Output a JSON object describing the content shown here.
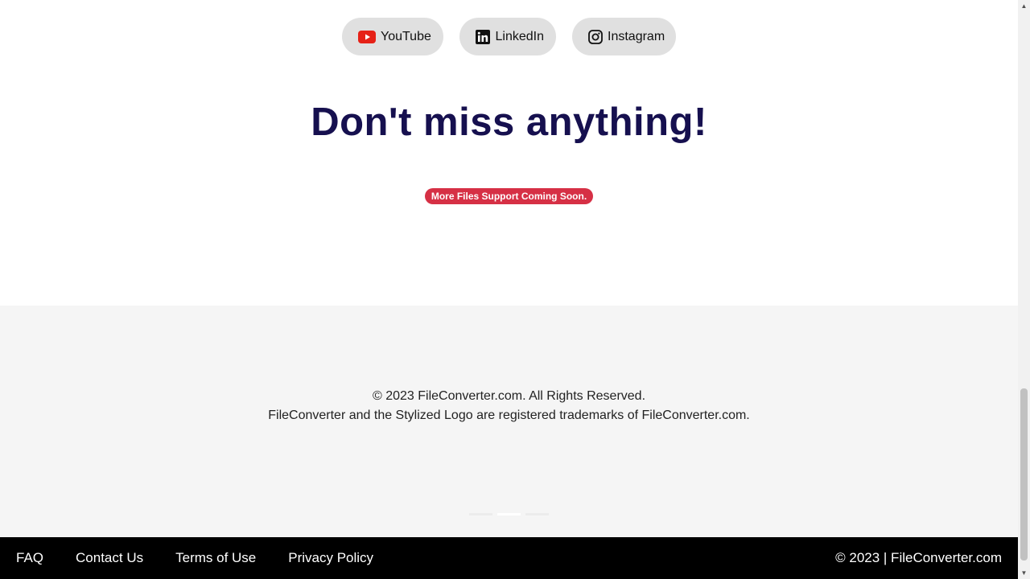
{
  "social": {
    "youtube": {
      "label": "YouTube",
      "icon": "youtube-icon",
      "color": "#e62117"
    },
    "linkedin": {
      "label": "LinkedIn",
      "icon": "linkedin-icon",
      "color": "#111111"
    },
    "instagram": {
      "label": "Instagram",
      "icon": "instagram-icon",
      "color": "#111111"
    }
  },
  "headline": "Don't miss anything!",
  "badge": "More Files Support Coming Soon.",
  "footer": {
    "copyright_line": "© 2023 FileConverter.com. All Rights Reserved.",
    "trademark_line": "FileConverter and the Stylized Logo are registered trademarks of FileConverter.com."
  },
  "carousel": {
    "active_index": 1,
    "count": 3
  },
  "bottom_nav": {
    "links": [
      "FAQ",
      "Contact Us",
      "Terms of Use",
      "Privacy Policy"
    ],
    "copyright": "© 2023 | FileConverter.com"
  },
  "colors": {
    "headline": "#16104f",
    "badge_bg": "#d63045",
    "pill_bg": "#e0e0e0",
    "footer_bg": "#f5f5f5",
    "bottom_bar_bg": "#000000"
  }
}
